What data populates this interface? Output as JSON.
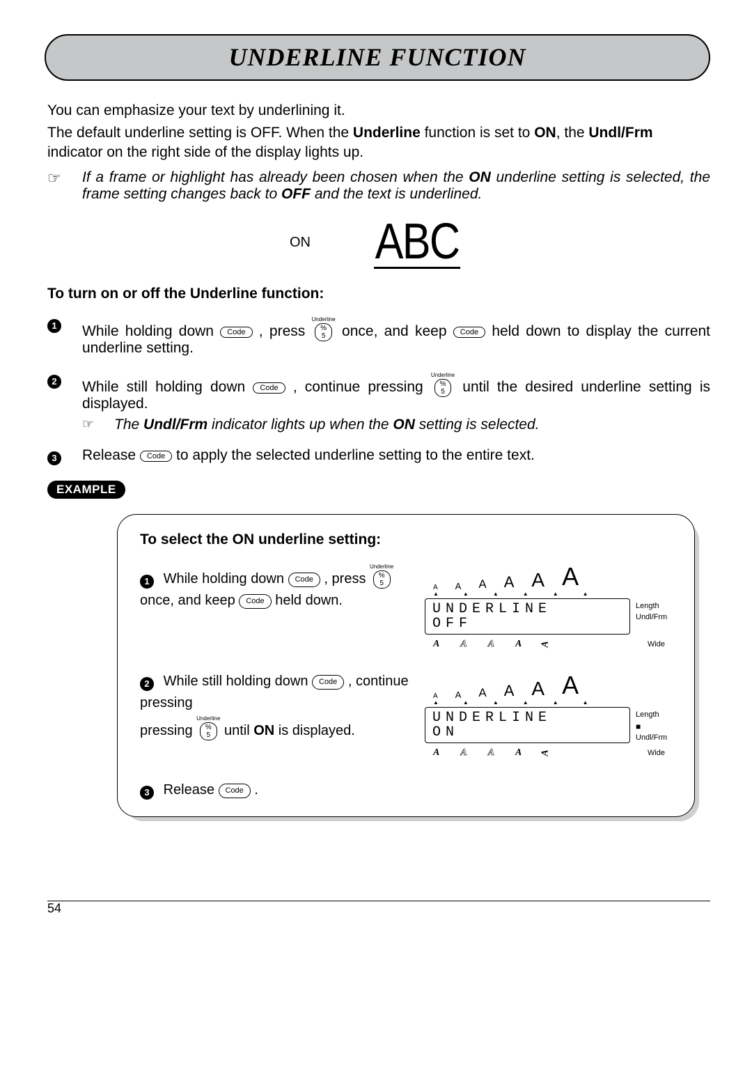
{
  "title": "UNDERLINE FUNCTION",
  "intro1": "You can emphasize your text by underlining it.",
  "intro2_a": "The default underline setting is OFF. When the ",
  "intro2_b": "Underline",
  "intro2_c": " function is set to ",
  "intro2_d": "ON",
  "intro2_e": ", the ",
  "intro2_f": "Undl/Frm",
  "intro2_g": " indicator on the right side of the display lights up.",
  "note1_a": "If a frame or highlight has already been chosen when the ",
  "note1_b": "ON",
  "note1_c": " underline setting is selected, the frame setting changes back to ",
  "note1_d": "OFF",
  "note1_e": " and the text is underlined.",
  "illus_on": "ON",
  "illus_abc": "ABC",
  "section_head": "To turn on or off the Underline function:",
  "step1_a": "While holding down ",
  "step1_b": " , press ",
  "step1_c": " once, and keep ",
  "step1_d": " held down to display the current underline setting.",
  "step2_a": "While still holding down ",
  "step2_b": " , continue pressing ",
  "step2_c": " until the desired underline setting is displayed.",
  "step2_note_a": "The ",
  "step2_note_b": "Undl/Frm",
  "step2_note_c": " indicator lights up when the ",
  "step2_note_d": "ON",
  "step2_note_e": " setting is selected.",
  "step3_a": "Release ",
  "step3_b": " to apply the selected underline setting to the entire text.",
  "example_label": "EXAMPLE",
  "example_head": "To select the ON underline setting:",
  "ex1_a": "While holding down ",
  "ex1_b": " , press ",
  "ex1_c": " once, and keep ",
  "ex1_d": " held down.",
  "ex2_a": "While still holding down ",
  "ex2_b": " , continue pressing ",
  "ex2_c": " until ",
  "ex2_d": "ON",
  "ex2_e": " is displayed.",
  "ex3_a": "Release ",
  "ex3_b": " .",
  "key_code": "Code",
  "key_ul_label": "Underline",
  "key_ul_top": "%",
  "key_ul_bot": "5",
  "lcd": {
    "line1_off": "UNDERLINE",
    "line2_off": "OFF",
    "line1_on": "UNDERLINE",
    "line2_on": "ON",
    "length": "Length",
    "undlfrm": "Undl/Frm",
    "wide": "Wide",
    "sizes_glyph": "A",
    "bottom_glyph": "A",
    "indicator": "■"
  },
  "page_num": "54"
}
